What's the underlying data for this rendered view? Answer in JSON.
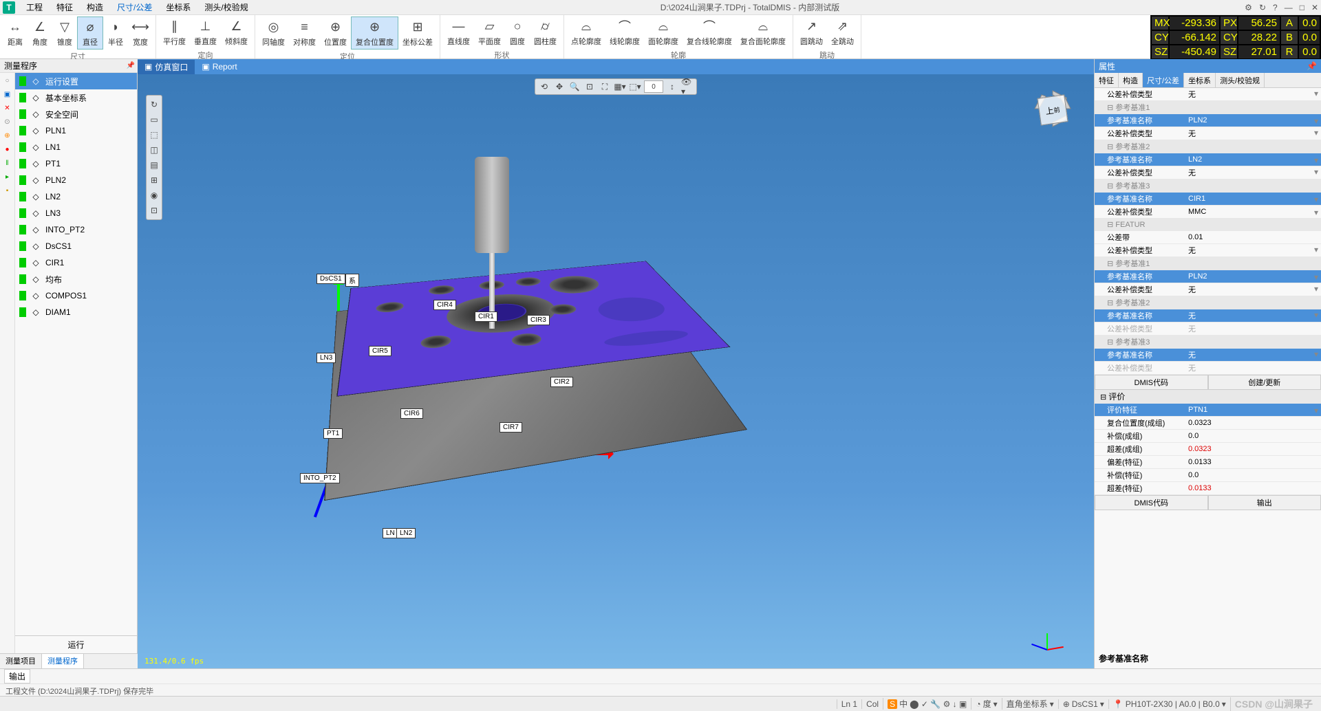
{
  "title": "D:\\2024山涧果子.TDPrj - TotalDMIS - 内部测试版",
  "menu": [
    "工程",
    "特征",
    "构造",
    "尺寸/公差",
    "坐标系",
    "测头/校验规"
  ],
  "menu_active": 3,
  "titlebar_icons": [
    "⚙",
    "↻",
    "?",
    "—",
    "□",
    "✕"
  ],
  "ribbon": {
    "groups": [
      {
        "label": "尺寸",
        "items": [
          "距离",
          "角度",
          "锥度",
          "直径",
          "半径",
          "宽度"
        ],
        "active": 3
      },
      {
        "label": "定向",
        "items": [
          "平行度",
          "垂直度",
          "倾斜度"
        ]
      },
      {
        "label": "定位",
        "items": [
          "同轴度",
          "对称度",
          "位置度",
          "复合位置度",
          "坐标公差"
        ],
        "active": 3
      },
      {
        "label": "形状",
        "items": [
          "直线度",
          "平面度",
          "圆度",
          "圆柱度"
        ]
      },
      {
        "label": "轮廓",
        "items": [
          "点轮廓度",
          "线轮廓度",
          "面轮廓度",
          "复合线轮廓度",
          "复合面轮廓度"
        ]
      },
      {
        "label": "跳动",
        "items": [
          "圆跳动",
          "全跳动"
        ]
      }
    ]
  },
  "dro": {
    "rows": [
      [
        "MX",
        "-293.36",
        "PX",
        "56.25",
        "A",
        "0.0"
      ],
      [
        "CY",
        "-66.142",
        "CY",
        "28.22",
        "B",
        "0.0"
      ],
      [
        "SZ",
        "-450.49",
        "SZ",
        "27.01",
        "R",
        "0.0"
      ]
    ]
  },
  "tree": {
    "title": "测量程序",
    "items": [
      {
        "label": "运行设置",
        "active": true
      },
      {
        "label": "基本坐标系"
      },
      {
        "label": "安全空间"
      },
      {
        "label": "PLN1"
      },
      {
        "label": "LN1"
      },
      {
        "label": "PT1"
      },
      {
        "label": "PLN2"
      },
      {
        "label": "LN2"
      },
      {
        "label": "LN3"
      },
      {
        "label": "INTO_PT2"
      },
      {
        "label": "DsCS1"
      },
      {
        "label": "CIR1"
      },
      {
        "label": "均布"
      },
      {
        "label": "COMPOS1"
      },
      {
        "label": "DIAM1"
      }
    ],
    "run_label": "运行",
    "tabs": [
      "测量项目",
      "测量程序"
    ],
    "tab_active": 1
  },
  "view": {
    "tabs": [
      {
        "label": "仿真窗口",
        "active": true
      },
      {
        "label": "Report"
      }
    ],
    "cube": {
      "top": "上",
      "front": "前"
    },
    "callouts": [
      "DsCS1",
      "系",
      "LN3",
      "PT1",
      "INTO_PT2",
      "LN",
      "LN2",
      "CIR1",
      "CIR2",
      "CIR3",
      "CIR4",
      "CIR5",
      "CIR6",
      "CIR7"
    ],
    "fps": "131.4/0.6 fps"
  },
  "props": {
    "title": "属性",
    "tabs": [
      "特征",
      "构造",
      "尺寸/公差",
      "坐标系",
      "测头/校验规"
    ],
    "tab_active": 2,
    "rows": [
      {
        "k": "公差补偿类型",
        "v": "无",
        "dd": true
      },
      {
        "k": "参考基准1",
        "group": true
      },
      {
        "k": "参考基准名称",
        "v": "PLN2",
        "hdr": true,
        "dd": true
      },
      {
        "k": "公差补偿类型",
        "v": "无",
        "dd": true
      },
      {
        "k": "参考基准2",
        "group": true
      },
      {
        "k": "参考基准名称",
        "v": "LN2",
        "hdr": true,
        "dd": true
      },
      {
        "k": "公差补偿类型",
        "v": "无",
        "dd": true
      },
      {
        "k": "参考基准3",
        "group": true
      },
      {
        "k": "参考基准名称",
        "v": "CIR1",
        "hdr": true,
        "dd": true
      },
      {
        "k": "公差补偿类型",
        "v": "MMC",
        "dd": true
      },
      {
        "k": "FEATUR",
        "group": true
      },
      {
        "k": "公差带",
        "v": "0.01"
      },
      {
        "k": "公差补偿类型",
        "v": "无",
        "dd": true
      },
      {
        "k": "参考基准1",
        "group": true
      },
      {
        "k": "参考基准名称",
        "v": "PLN2",
        "hdr": true,
        "dd": true
      },
      {
        "k": "公差补偿类型",
        "v": "无",
        "dd": true
      },
      {
        "k": "参考基准2",
        "group": true
      },
      {
        "k": "参考基准名称",
        "v": "无",
        "hdr": true,
        "dd": true
      },
      {
        "k": "公差补偿类型",
        "v": "无",
        "dim": true
      },
      {
        "k": "参考基准3",
        "group": true
      },
      {
        "k": "参考基准名称",
        "v": "无",
        "hdr": true,
        "dd": true
      },
      {
        "k": "公差补偿类型",
        "v": "无",
        "dim": true
      }
    ],
    "dmis_btn1": [
      "DMIS代码",
      "创建/更新"
    ],
    "eval_header": "评价",
    "eval_rows": [
      {
        "k": "评价特征",
        "v": "PTN1",
        "hdr": true,
        "dd": true
      },
      {
        "k": "复合位置度(成组)",
        "v": "0.0323"
      },
      {
        "k": "补偿(成组)",
        "v": "0.0"
      },
      {
        "k": "超差(成组)",
        "v": "0.0323",
        "red": true
      },
      {
        "k": "偏差(特征)",
        "v": "0.0133"
      },
      {
        "k": "补偿(特征)",
        "v": "0.0"
      },
      {
        "k": "超差(特征)",
        "v": "0.0133",
        "red": true
      }
    ],
    "dmis_btn2": [
      "DMIS代码",
      "输出"
    ],
    "detail_label": "参考基准名称"
  },
  "output": {
    "tab": "输出",
    "text": "工程文件 (D:\\2024山涧果子.TDPrj) 保存完毕"
  },
  "status": {
    "left": "",
    "ln": "Ln 1",
    "col": "Col",
    "ime": "中",
    "deg": "度",
    "coord": "直角坐标系",
    "cs": "DsCS1",
    "probe": "PH10T-2X30 | A0.0 | B0.0",
    "watermark": "CSDN @山涧果子"
  }
}
